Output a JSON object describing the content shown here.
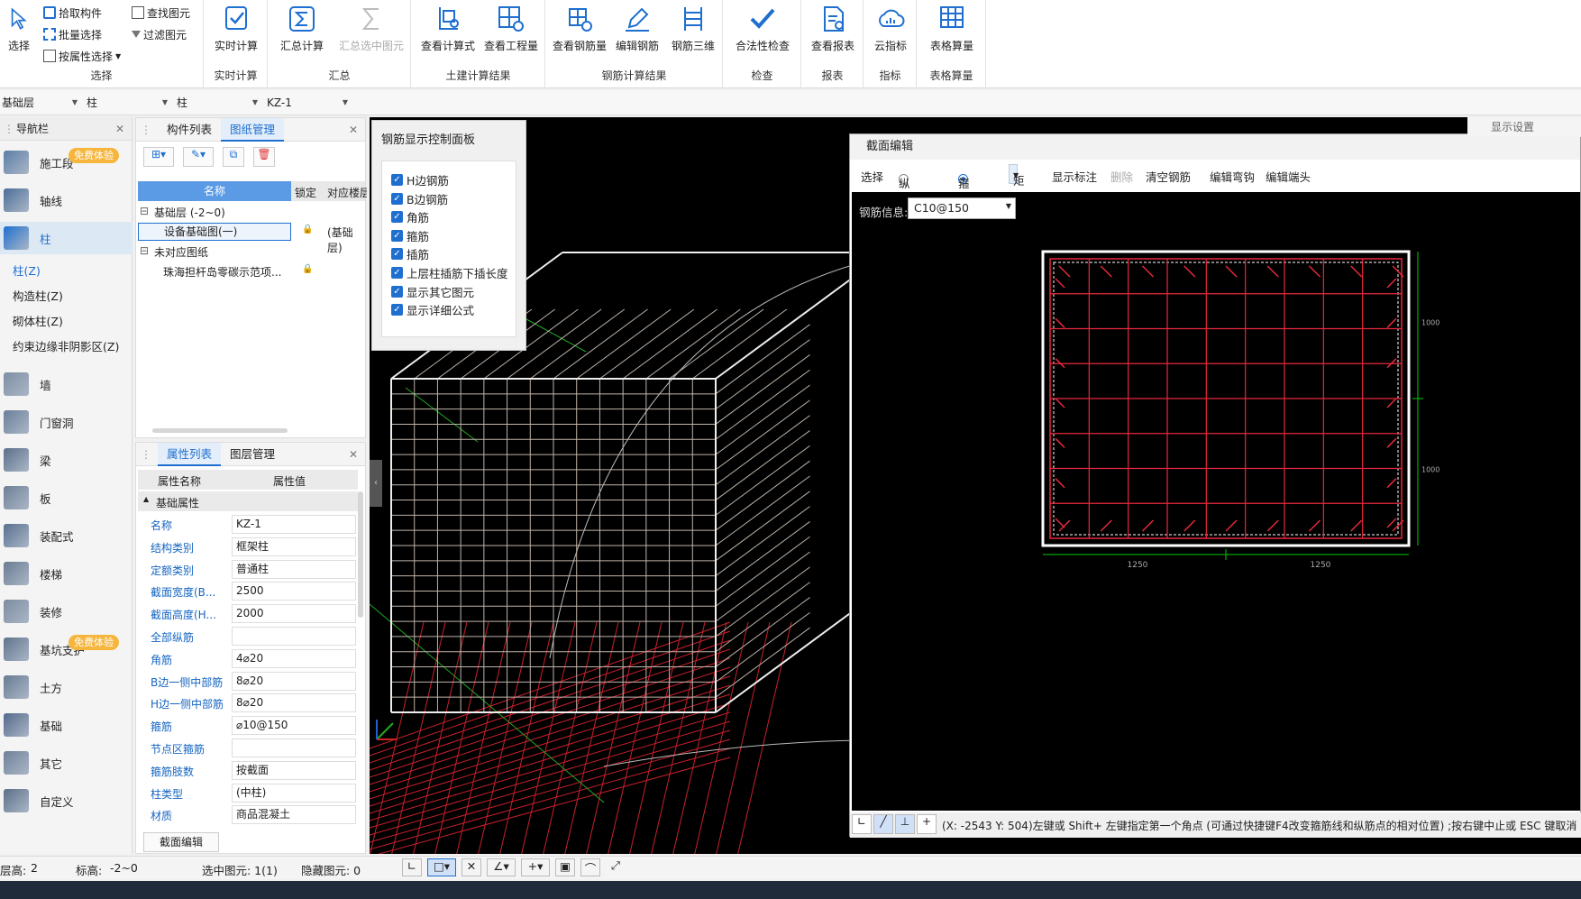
{
  "ribbon": {
    "groups": [
      {
        "label": "选择"
      },
      {
        "label": "实时计算"
      },
      {
        "label": "汇总"
      },
      {
        "label": "土建计算结果"
      },
      {
        "label": "钢筋计算结果"
      },
      {
        "label": "检查"
      },
      {
        "label": "报表"
      },
      {
        "label": "指标"
      },
      {
        "label": "表格算量"
      }
    ],
    "select_btn": "选择",
    "pick_component": "拾取构件",
    "batch_select": "批量选择",
    "select_by_attr": "按属性选择",
    "find_element": "查找图元",
    "filter_element": "过滤图元",
    "realtime_calc": "实时计算",
    "sum_calc": "汇总计算",
    "sum_selected": "汇总选中图元",
    "view_formula": "查看计算式",
    "view_quantity": "查看工程量",
    "view_rebar_qty": "查看钢筋量",
    "edit_rebar": "编辑钢筋",
    "rebar_3d": "钢筋三维",
    "validity_check": "合法性检查",
    "view_report": "查看报表",
    "cloud_index": "云指标",
    "table_calc": "表格算量"
  },
  "selectors": {
    "floor": "基础层",
    "type1": "柱",
    "type2": "柱",
    "name": "KZ-1"
  },
  "nav": {
    "title": "导航栏",
    "items": [
      {
        "label": "施工段",
        "badge": "免费体验"
      },
      {
        "label": "轴线"
      },
      {
        "label": "柱"
      },
      {
        "label": "墙"
      },
      {
        "label": "门窗洞"
      },
      {
        "label": "梁"
      },
      {
        "label": "板"
      },
      {
        "label": "装配式"
      },
      {
        "label": "楼梯"
      },
      {
        "label": "装修"
      },
      {
        "label": "基坑支护",
        "badge": "免费体验"
      },
      {
        "label": "土方"
      },
      {
        "label": "基础"
      },
      {
        "label": "其它"
      },
      {
        "label": "自定义"
      }
    ],
    "subitems": [
      "柱(Z)",
      "构造柱(Z)",
      "砌体柱(Z)",
      "约束边缘非阴影区(Z)"
    ]
  },
  "component_panel": {
    "tabs": [
      "构件列表",
      "图纸管理"
    ],
    "headers": [
      "名称",
      "锁定",
      "对应楼层"
    ],
    "rows": [
      {
        "name": "基础层 (-2~0)",
        "level": 0
      },
      {
        "name": "设备基础图(一)",
        "level": 1,
        "floor": "(基础层)"
      },
      {
        "name": "未对应图纸",
        "level": 0
      },
      {
        "name": "珠海担杆岛零碳示范项...",
        "level": 1,
        "floor": ""
      }
    ]
  },
  "property_panel": {
    "tabs": [
      "属性列表",
      "图层管理"
    ],
    "headers": [
      "属性名称",
      "属性值"
    ],
    "group": "基础属性",
    "rows": [
      {
        "name": "名称",
        "value": "KZ-1"
      },
      {
        "name": "结构类别",
        "value": "框架柱"
      },
      {
        "name": "定额类别",
        "value": "普通柱"
      },
      {
        "name": "截面宽度(B...",
        "value": "2500"
      },
      {
        "name": "截面高度(H...",
        "value": "2000"
      },
      {
        "name": "全部纵筋",
        "value": ""
      },
      {
        "name": "角筋",
        "value": "4⌀20"
      },
      {
        "name": "B边一侧中部筋",
        "value": "8⌀20"
      },
      {
        "name": "H边一侧中部筋",
        "value": "8⌀20"
      },
      {
        "name": "箍筋",
        "value": "⌀10@150"
      },
      {
        "name": "节点区箍筋",
        "value": ""
      },
      {
        "name": "箍筋肢数",
        "value": "按截面"
      },
      {
        "name": "柱类型",
        "value": "(中柱)"
      },
      {
        "name": "材质",
        "value": "商品混凝土"
      }
    ],
    "section_edit_btn": "截面编辑"
  },
  "rebar_control": {
    "title": "钢筋显示控制面板",
    "items": [
      "H边钢筋",
      "B边钢筋",
      "角筋",
      "箍筋",
      "插筋",
      "上层柱插筋下插长度",
      "显示其它图元",
      "显示详细公式"
    ]
  },
  "section_editor": {
    "title": "截面编辑",
    "toolbar": {
      "select": "选择",
      "longitudinal": "纵筋",
      "stirrup": "箍筋",
      "shape": "矩形",
      "show_label": "显示标注",
      "delete": "删除",
      "clear": "清空钢筋",
      "edit_hook": "编辑弯钩",
      "edit_end": "编辑端头"
    },
    "rebar_info_label": "钢筋信息:",
    "rebar_info_value": "C10@150",
    "status_text": "(X: -2543 Y: 504)左键或 Shift+ 左键指定第一个角点 (可通过快捷键F4改变箍筋线和纵筋点的相对位置) ;按右键中止或 ESC 键取消",
    "dims": [
      "1250",
      "1250",
      "1000",
      "1000"
    ]
  },
  "side_panel": {
    "display_settings": "显示设置"
  },
  "status_bar": {
    "floor_height": "层高:",
    "floor_height_value": "2",
    "elevation": "标高:",
    "elevation_value": "-2~0",
    "selected": "选中图元: 1(1)",
    "hidden": "隐藏图元: 0"
  },
  "colors": {
    "accent": "#1e6fd0",
    "rebar_red": "#e8283c",
    "badge": "#f6b53c",
    "canvas": "#000000"
  }
}
